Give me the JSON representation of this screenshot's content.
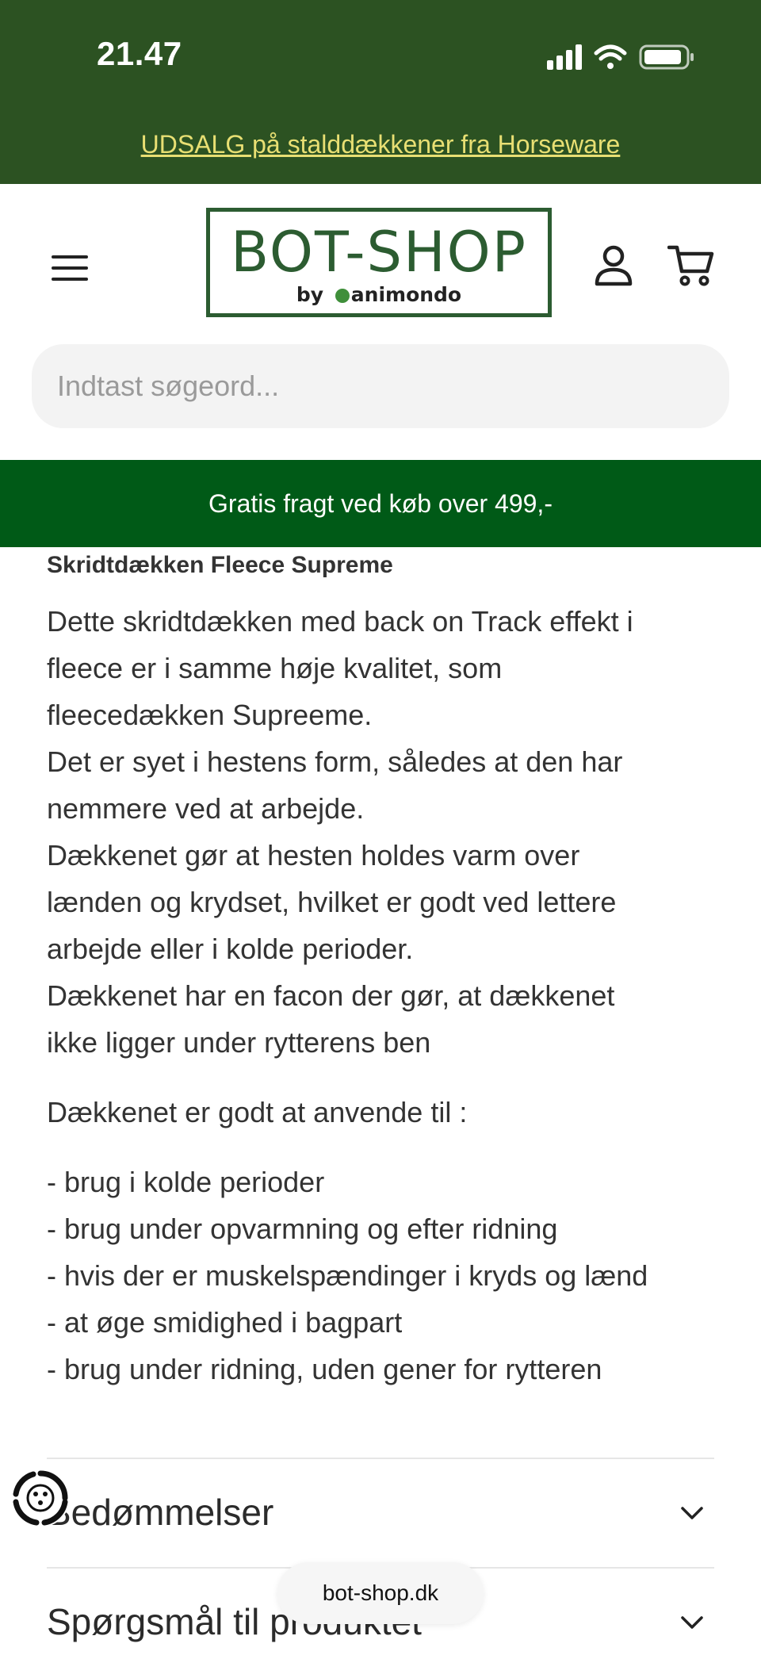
{
  "status_bar": {
    "time": "21.47",
    "icons": [
      "signal-icon",
      "wifi-icon",
      "battery-icon"
    ]
  },
  "announcement": {
    "text": "UDSALG på stalddækkener fra Horseware",
    "color": "#e8df73"
  },
  "header": {
    "logo": {
      "main": "BOT-SHOP",
      "sub_prefix": "by",
      "sub_brand": "animondo"
    },
    "icons": [
      "menu-icon",
      "account-icon",
      "cart-icon"
    ]
  },
  "search": {
    "placeholder": "Indtast søgeord..."
  },
  "shipping_bar": {
    "text": "Gratis fragt ved køb over 499,-",
    "color": "#005a17"
  },
  "product": {
    "title": "Skridtdækken Fleece Supreme",
    "description_lines": [
      "Dette skridtdækken med back on Track effekt i",
      "fleece er i samme høje kvalitet, som",
      "fleecedækken Supreeme.",
      "Det er syet i hestens form, således at den har",
      "nemmere ved at arbejde.",
      "Dækkenet gør at hesten holdes varm over",
      "lænden og krydset, hvilket er godt ved lettere",
      "arbejde eller i kolde perioder.",
      "Dækkenet har en facon der gør, at dækkenet",
      "ikke ligger under rytterens ben"
    ],
    "use_intro": "Dækkenet er godt at anvende til :",
    "uses": [
      "- brug i kolde perioder",
      "- brug under opvarmning og efter ridning",
      "- hvis der er muskelspændinger i kryds og lænd",
      "- at øge smidighed i bagpart",
      "- brug under ridning, uden gener for rytteren"
    ]
  },
  "accordions": [
    {
      "label": "Bedømmelser"
    },
    {
      "label": "Spørgsmål til produktet"
    }
  ],
  "url_pill": {
    "text": "bot-shop.dk"
  },
  "theme": {
    "header_green": "#2c5222",
    "logo_green": "#2c5c31"
  }
}
